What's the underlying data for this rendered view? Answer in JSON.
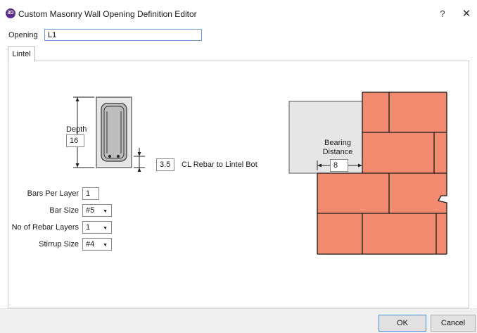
{
  "window": {
    "app_icon_text": "3D",
    "title": "Custom Masonry Wall Opening Definition Editor",
    "help_label": "?",
    "close_label": "✕"
  },
  "opening": {
    "label": "Opening",
    "value": "L1"
  },
  "tabs": [
    {
      "label": "Lintel",
      "active": true
    }
  ],
  "lintel": {
    "depth_label": "Depth",
    "depth_value": "16",
    "cl_rebar_value": "3.5",
    "cl_rebar_label": "CL Rebar to Lintel Bot",
    "bars_per_layer_label": "Bars Per Layer",
    "bars_per_layer_value": "1",
    "bar_size_label": "Bar Size",
    "bar_size_value": "#5",
    "rebar_layers_label": "No of Rebar Layers",
    "rebar_layers_value": "1",
    "stirrup_size_label": "Stirrup Size",
    "stirrup_size_value": "#4"
  },
  "bearing": {
    "label_line1": "Bearing",
    "label_line2": "Distance",
    "value": "8"
  },
  "colors": {
    "brick": "#f28a70",
    "mortar": "#1a1a1a",
    "lintel_fill": "#e6e6e6",
    "accent": "#5b2c8f"
  },
  "buttons": {
    "ok": "OK",
    "cancel": "Cancel"
  }
}
